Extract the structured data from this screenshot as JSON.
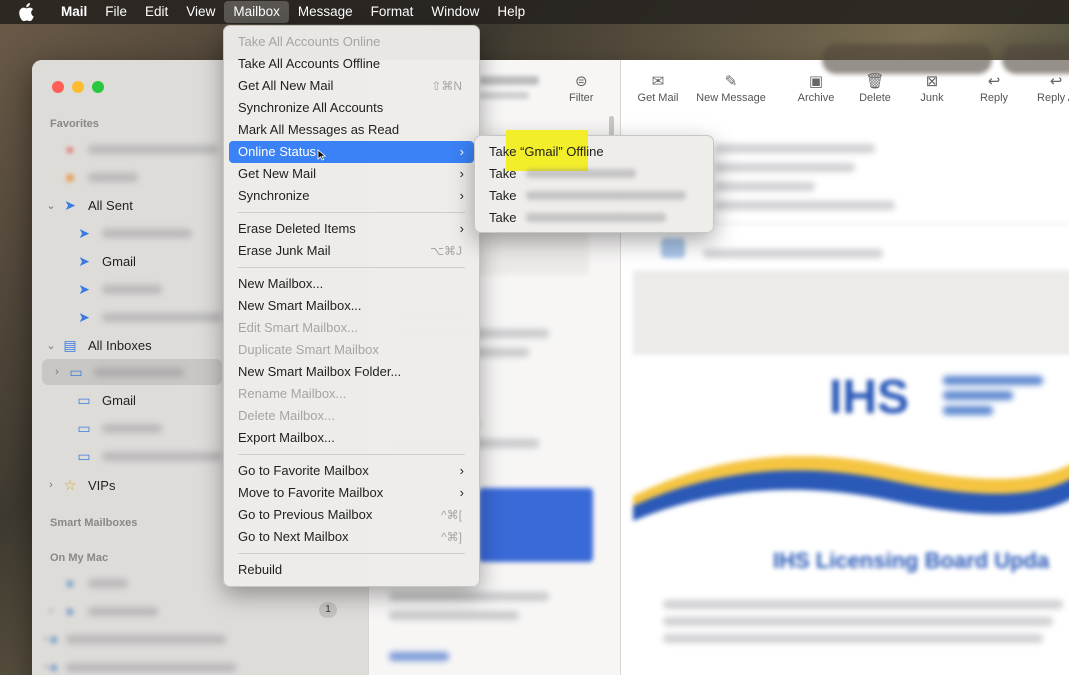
{
  "menubar": {
    "items": [
      "Mail",
      "File",
      "Edit",
      "View",
      "Mailbox",
      "Message",
      "Format",
      "Window",
      "Help"
    ],
    "active": "Mailbox"
  },
  "mailbox_menu": {
    "items": [
      {
        "label": "Take All Accounts Online",
        "disabled": true,
        "shortcut": "",
        "submenu": false
      },
      {
        "label": "Take All Accounts Offline",
        "disabled": false,
        "shortcut": "",
        "submenu": false
      },
      {
        "label": "Get All New Mail",
        "disabled": false,
        "shortcut": "⇧⌘N",
        "submenu": false
      },
      {
        "label": "Synchronize All Accounts",
        "disabled": false,
        "shortcut": "",
        "submenu": false
      },
      {
        "label": "Mark All Messages as Read",
        "disabled": false,
        "shortcut": "",
        "submenu": false
      },
      {
        "label": "Online Status",
        "disabled": false,
        "shortcut": "",
        "submenu": true,
        "highlighted": true
      },
      {
        "label": "Get New Mail",
        "disabled": false,
        "shortcut": "",
        "submenu": true
      },
      {
        "label": "Synchronize",
        "disabled": false,
        "shortcut": "",
        "submenu": true
      },
      {
        "separator": true
      },
      {
        "label": "Erase Deleted Items",
        "disabled": false,
        "shortcut": "",
        "submenu": true
      },
      {
        "label": "Erase Junk Mail",
        "disabled": false,
        "shortcut": "⌥⌘J",
        "submenu": false
      },
      {
        "separator": true
      },
      {
        "label": "New Mailbox...",
        "disabled": false,
        "shortcut": "",
        "submenu": false
      },
      {
        "label": "New Smart Mailbox...",
        "disabled": false,
        "shortcut": "",
        "submenu": false
      },
      {
        "label": "Edit Smart Mailbox...",
        "disabled": true,
        "shortcut": "",
        "submenu": false
      },
      {
        "label": "Duplicate Smart Mailbox",
        "disabled": true,
        "shortcut": "",
        "submenu": false
      },
      {
        "label": "New Smart Mailbox Folder...",
        "disabled": false,
        "shortcut": "",
        "submenu": false
      },
      {
        "label": "Rename Mailbox...",
        "disabled": true,
        "shortcut": "",
        "submenu": false
      },
      {
        "label": "Delete Mailbox...",
        "disabled": true,
        "shortcut": "",
        "submenu": false
      },
      {
        "label": "Export Mailbox...",
        "disabled": false,
        "shortcut": "",
        "submenu": false
      },
      {
        "separator": true
      },
      {
        "label": "Go to Favorite Mailbox",
        "disabled": false,
        "shortcut": "",
        "submenu": true
      },
      {
        "label": "Move to Favorite Mailbox",
        "disabled": false,
        "shortcut": "",
        "submenu": true
      },
      {
        "label": "Go to Previous Mailbox",
        "disabled": false,
        "shortcut": "^⌘[",
        "submenu": false
      },
      {
        "label": "Go to Next Mailbox",
        "disabled": false,
        "shortcut": "^⌘]",
        "submenu": false
      },
      {
        "separator": true
      },
      {
        "label": "Rebuild",
        "disabled": false,
        "shortcut": "",
        "submenu": false
      }
    ]
  },
  "online_status_submenu": {
    "items": [
      {
        "label": "Take “Gmail” Offline",
        "emphasized": true
      },
      {
        "label": "Take",
        "emphasized": false
      },
      {
        "label": "Take",
        "emphasized": false
      },
      {
        "label": "Take",
        "emphasized": false
      }
    ]
  },
  "sidebar": {
    "favorites_header": "Favorites",
    "all_sent": "All Sent",
    "sent_gmail": "Gmail",
    "all_inboxes": "All Inboxes",
    "inbox_gmail": "Gmail",
    "vips": "VIPs",
    "smart_mailboxes_header": "Smart Mailboxes",
    "on_my_mac_header": "On My Mac",
    "badge_count": "1"
  },
  "toolbar": {
    "filter": "Filter",
    "get_mail": "Get Mail",
    "new_message": "New Message",
    "archive": "Archive",
    "delete": "Delete",
    "junk": "Junk",
    "reply": "Reply",
    "reply_all": "Reply A"
  },
  "viewer": {
    "logo_text": "IHS",
    "headline": "IHS Licensing Board Upda"
  },
  "colors": {
    "highlight": "#3b82f6",
    "marker": "#f2ee2a"
  }
}
